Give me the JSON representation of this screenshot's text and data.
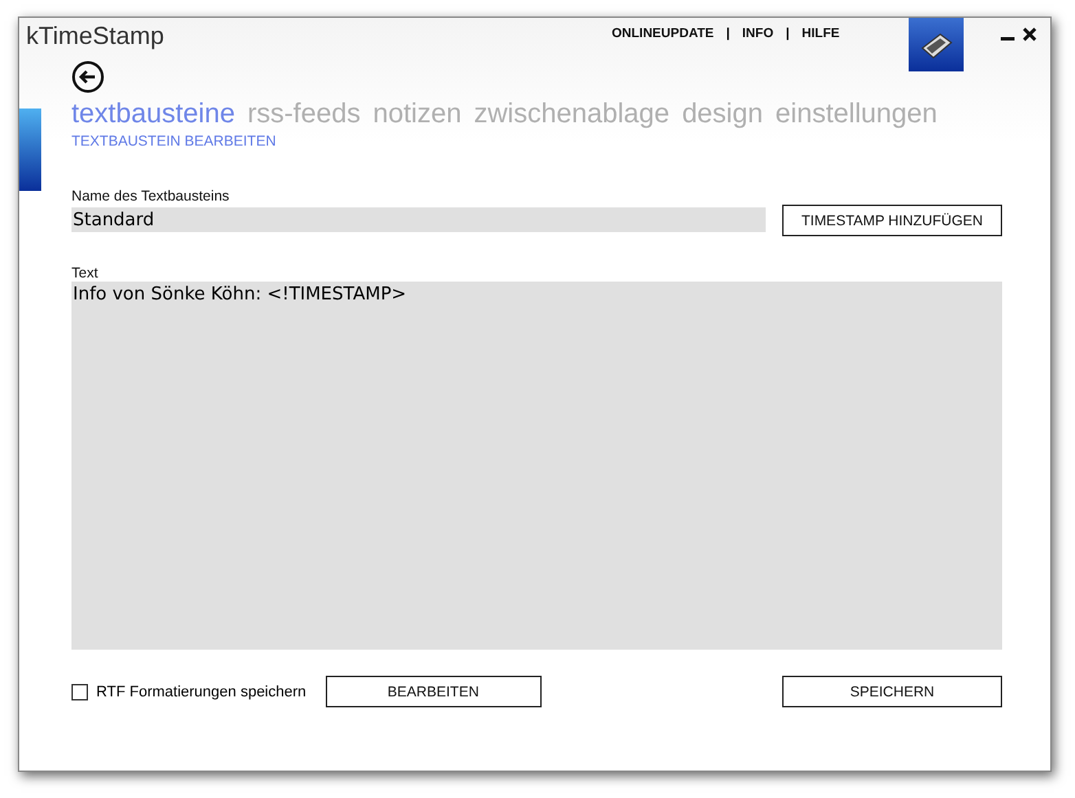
{
  "window": {
    "title": "kTimeStamp"
  },
  "top_links": [
    "ONLINEUPDATE",
    "INFO",
    "HILFE"
  ],
  "top_separators": [
    "|",
    "|"
  ],
  "tabs": [
    {
      "label": "textbausteine",
      "selected": true
    },
    {
      "label": "rss-feeds",
      "selected": false
    },
    {
      "label": "notizen",
      "selected": false
    },
    {
      "label": "zwischenablage",
      "selected": false
    },
    {
      "label": "design",
      "selected": false
    },
    {
      "label": "einstellungen",
      "selected": false
    }
  ],
  "subtitle": "TEXTBAUSTEIN BEARBEITEN",
  "name_field": {
    "label": "Name des Textbausteins",
    "value": "Standard"
  },
  "timestamp_button": "TIMESTAMP HINZUFÜGEN",
  "text_field": {
    "label": "Text",
    "value": "Info von Sönke Köhn: <!TIMESTAMP>"
  },
  "rtf_checkbox": {
    "label": "RTF Formatierungen speichern",
    "checked": false
  },
  "edit_button": "BEARBEITEN",
  "save_button": "SPEICHERN"
}
